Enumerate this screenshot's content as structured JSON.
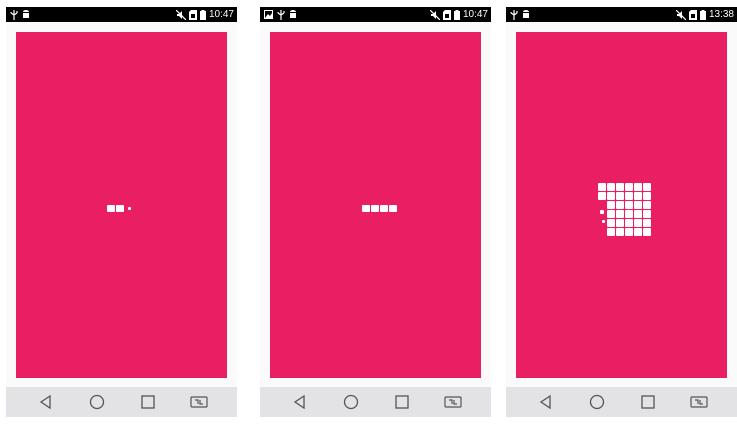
{
  "colors": {
    "accent": "#e91e63",
    "status_bar": "#000000",
    "nav_bar": "#e3e3e6",
    "loader": "#ffffff"
  },
  "screens": [
    {
      "clock": "10:47",
      "status_left_icons": [
        "usb-icon",
        "android-debug-icon"
      ],
      "status_right_icons": [
        "mute-icon",
        "sim-icon",
        "battery-icon"
      ],
      "loader_state": "2 squares + small dot"
    },
    {
      "clock": "10:47",
      "status_left_icons": [
        "image-icon",
        "usb-icon",
        "android-debug-icon"
      ],
      "status_right_icons": [
        "mute-icon",
        "sim-icon",
        "battery-icon"
      ],
      "loader_state": "4 squares in a row"
    },
    {
      "clock": "13:38",
      "status_left_icons": [
        "usb-icon",
        "android-debug-icon"
      ],
      "status_right_icons": [
        "mute-icon",
        "sim-icon",
        "battery-icon"
      ],
      "loader_state": "6x6 grid filling"
    }
  ],
  "nav_buttons": [
    "back-icon",
    "home-icon",
    "recents-icon",
    "dual-window-icon"
  ]
}
